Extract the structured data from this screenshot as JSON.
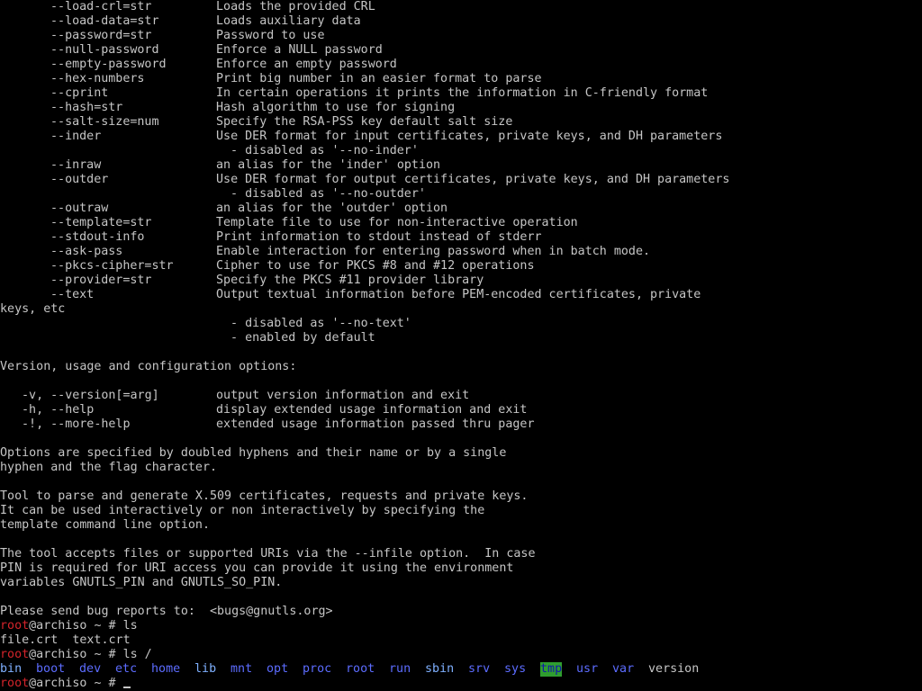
{
  "terminal": {
    "options": [
      {
        "opt": "--load-crl=str",
        "desc": "Loads the provided CRL"
      },
      {
        "opt": "--load-data=str",
        "desc": "Loads auxiliary data"
      },
      {
        "opt": "--password=str",
        "desc": "Password to use"
      },
      {
        "opt": "--null-password",
        "desc": "Enforce a NULL password"
      },
      {
        "opt": "--empty-password",
        "desc": "Enforce an empty password"
      },
      {
        "opt": "--hex-numbers",
        "desc": "Print big number in an easier format to parse"
      },
      {
        "opt": "--cprint",
        "desc": "In certain operations it prints the information in C-friendly format"
      },
      {
        "opt": "--hash=str",
        "desc": "Hash algorithm to use for signing"
      },
      {
        "opt": "--salt-size=num",
        "desc": "Specify the RSA-PSS key default salt size"
      },
      {
        "opt": "--inder",
        "desc": "Use DER format for input certificates, private keys, and DH parameters"
      },
      {
        "sub": "- disabled as '--no-inder'"
      },
      {
        "opt": "--inraw",
        "desc": "an alias for the 'inder' option"
      },
      {
        "opt": "--outder",
        "desc": "Use DER format for output certificates, private keys, and DH parameters"
      },
      {
        "sub": "- disabled as '--no-outder'"
      },
      {
        "opt": "--outraw",
        "desc": "an alias for the 'outder' option"
      },
      {
        "opt": "--template=str",
        "desc": "Template file to use for non-interactive operation"
      },
      {
        "opt": "--stdout-info",
        "desc": "Print information to stdout instead of stderr"
      },
      {
        "opt": "--ask-pass",
        "desc": "Enable interaction for entering password when in batch mode."
      },
      {
        "opt": "--pkcs-cipher=str",
        "desc": "Cipher to use for PKCS #8 and #12 operations"
      },
      {
        "opt": "--provider=str",
        "desc": "Specify the PKCS #11 provider library"
      },
      {
        "opt": "--text",
        "desc": "Output textual information before PEM-encoded certificates, private"
      },
      {
        "plain": "keys, etc"
      },
      {
        "sub": "- disabled as '--no-text'"
      },
      {
        "sub": "- enabled by default"
      }
    ],
    "version_header": "Version, usage and configuration options:",
    "version_options": [
      {
        "opt": "-v, --version[=arg]",
        "desc": "output version information and exit"
      },
      {
        "opt": "-h, --help",
        "desc": "display extended usage information and exit"
      },
      {
        "opt": "-!, --more-help",
        "desc": "extended usage information passed thru pager"
      }
    ],
    "para1": [
      "Options are specified by doubled hyphens and their name or by a single",
      "hyphen and the flag character."
    ],
    "para2": [
      "Tool to parse and generate X.509 certificates, requests and private keys.",
      "It can be used interactively or non interactively by specifying the",
      "template command line option."
    ],
    "para3": [
      "The tool accepts files or supported URIs via the --infile option.  In case",
      "PIN is required for URI access you can provide it using the environment",
      "variables GNUTLS_PIN and GNUTLS_SO_PIN."
    ],
    "bug_report": "Please send bug reports to:  <bugs@gnutls.org>",
    "prompt_user": "root",
    "prompt_rest": "@archiso ~ # ",
    "cmd1": "ls",
    "ls_output": "file.crt  text.crt",
    "cmd2": "ls /",
    "root_entries": [
      {
        "name": "bin",
        "style": "cyan-b"
      },
      {
        "name": "boot",
        "style": "dir"
      },
      {
        "name": "dev",
        "style": "dir"
      },
      {
        "name": "etc",
        "style": "dir"
      },
      {
        "name": "home",
        "style": "dir"
      },
      {
        "name": "lib",
        "style": "cyan-b"
      },
      {
        "name": "mnt",
        "style": "dir"
      },
      {
        "name": "opt",
        "style": "dir"
      },
      {
        "name": "proc",
        "style": "dir"
      },
      {
        "name": "root",
        "style": "dir"
      },
      {
        "name": "run",
        "style": "dir"
      },
      {
        "name": "sbin",
        "style": "cyan-b"
      },
      {
        "name": "srv",
        "style": "dir"
      },
      {
        "name": "sys",
        "style": "dir"
      },
      {
        "name": "tmp",
        "style": "tmpdir"
      },
      {
        "name": "usr",
        "style": "dir"
      },
      {
        "name": "var",
        "style": "dir"
      },
      {
        "name": "version",
        "style": "plain"
      }
    ],
    "colors": {
      "background": "#000000",
      "text": "#c6c6c6",
      "prompt_user": "#d4242b",
      "dir": "#5c6cff",
      "tmp_bg": "#2f9e2f"
    }
  }
}
